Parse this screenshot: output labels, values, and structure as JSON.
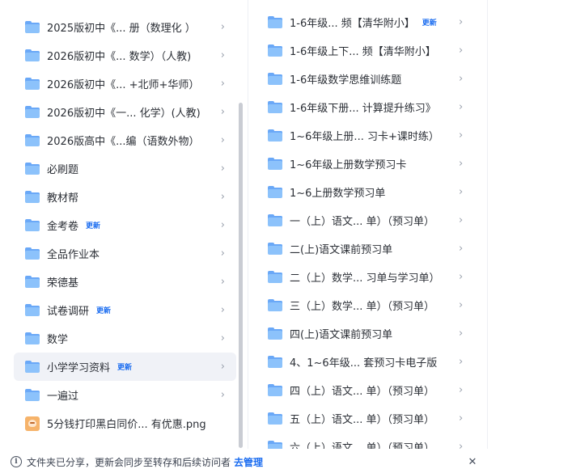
{
  "left_panel": {
    "items": [
      {
        "icon": "folder-icon",
        "label": "2025版初中《...   册（数理化 ）",
        "badge": ""
      },
      {
        "icon": "folder-icon",
        "label": "2026版初中《...   数学）（人教)",
        "badge": ""
      },
      {
        "icon": "folder-icon",
        "label": "2026版初中《...   +北师+华师）",
        "badge": ""
      },
      {
        "icon": "folder-icon",
        "label": "2026版初中《一...  化学）(人教)",
        "badge": ""
      },
      {
        "icon": "folder-icon",
        "label": "2026版高中《...编（语数外物）",
        "badge": ""
      },
      {
        "icon": "folder-icon",
        "label": "必刷题",
        "badge": ""
      },
      {
        "icon": "folder-icon",
        "label": "教材帮",
        "badge": ""
      },
      {
        "icon": "folder-icon",
        "label": "金考卷",
        "badge": "更新"
      },
      {
        "icon": "folder-icon",
        "label": "全品作业本",
        "badge": ""
      },
      {
        "icon": "folder-icon",
        "label": "荣德基",
        "badge": ""
      },
      {
        "icon": "folder-icon",
        "label": "试卷调研",
        "badge": "更新"
      },
      {
        "icon": "folder-icon",
        "label": "数学",
        "badge": ""
      },
      {
        "icon": "folder-icon",
        "label": "小学学习资料",
        "badge": "更新",
        "selected": true
      },
      {
        "icon": "folder-icon",
        "label": "一遍过",
        "badge": ""
      },
      {
        "icon": "image-file-icon",
        "label": "5分钱打印黑白同价...   有优惠.png",
        "badge": ""
      }
    ]
  },
  "right_panel": {
    "items": [
      {
        "label": "1-6年级...  频【清华附小】",
        "badge": "更新"
      },
      {
        "label": "1-6年级上下...   频【清华附小】",
        "badge": ""
      },
      {
        "label": "1-6年级数学思维训练题",
        "badge": ""
      },
      {
        "label": "1-6年级下册...   计算提升练习》",
        "badge": ""
      },
      {
        "label": "1~6年级上册...   习卡+课时练）",
        "badge": ""
      },
      {
        "label": "1~6年级上册数学预习卡",
        "badge": ""
      },
      {
        "label": "1~6上册数学预习单",
        "badge": ""
      },
      {
        "label": "一（上）语文...  单）（预习单）",
        "badge": ""
      },
      {
        "label": "二(上)语文课前预习单",
        "badge": ""
      },
      {
        "label": "二（上）数学...  习单与学习单）",
        "badge": ""
      },
      {
        "label": "三（上）数学...  单）（预习单）",
        "badge": ""
      },
      {
        "label": "四(上)语文课前预习单",
        "badge": ""
      },
      {
        "label": "4、1~6年级...   套预习卡电子版",
        "badge": ""
      },
      {
        "label": "四（上）语文...  单）（预习单）",
        "badge": ""
      },
      {
        "label": "五（上）语文...  单）（预习单）",
        "badge": ""
      },
      {
        "label": "六（上）语文...  单）（预习单）",
        "badge": ""
      }
    ]
  },
  "bottom_bar": {
    "notice": "文件夹已分享，更新会同步至转存和后续访问者",
    "manage_link": "去管理",
    "info_icon": "i",
    "close_icon": "✕"
  },
  "chevron": "›",
  "colors": {
    "accent": "#1a6cf0",
    "folder": "#8cc2fb",
    "selected_bg": "#f0f2f7"
  }
}
